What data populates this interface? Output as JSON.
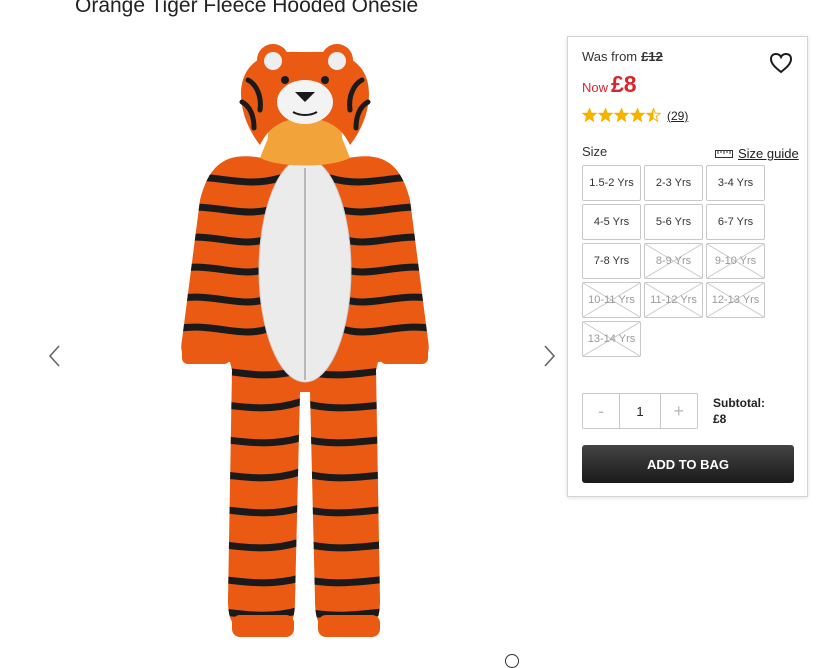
{
  "product": {
    "title": "Orange Tiger Fleece Hooded Onesie",
    "was_label": "Was from",
    "was_price": "£12",
    "now_label": "Now",
    "now_price": "£8",
    "rating": 4.5,
    "review_count": "(29)"
  },
  "icons": {
    "wishlist": "heart-outline-icon",
    "size_guide": "ruler-icon",
    "prev": "chevron-left-icon",
    "next": "chevron-right-icon"
  },
  "colors": {
    "sale_red": "#d8262e",
    "star_gold": "#f5b300",
    "button_dark": "#2a2a2a"
  },
  "sizes": {
    "label": "Size",
    "guide_label": "Size guide",
    "options": [
      {
        "label": "1.5-2 Yrs",
        "available": true
      },
      {
        "label": "2-3 Yrs",
        "available": true
      },
      {
        "label": "3-4 Yrs",
        "available": true
      },
      {
        "label": "4-5 Yrs",
        "available": true
      },
      {
        "label": "5-6 Yrs",
        "available": true
      },
      {
        "label": "6-7 Yrs",
        "available": true
      },
      {
        "label": "7-8 Yrs",
        "available": true
      },
      {
        "label": "8-9 Yrs",
        "available": false
      },
      {
        "label": "9-10 Yrs",
        "available": false
      },
      {
        "label": "10-11 Yrs",
        "available": false
      },
      {
        "label": "11-12 Yrs",
        "available": false
      },
      {
        "label": "12-13 Yrs",
        "available": false
      },
      {
        "label": "13-14 Yrs",
        "available": false
      }
    ]
  },
  "quantity": {
    "minus": "-",
    "value": "1",
    "plus": "+"
  },
  "subtotal": {
    "label": "Subtotal:",
    "value": "£8"
  },
  "add_to_bag": "ADD TO BAG"
}
